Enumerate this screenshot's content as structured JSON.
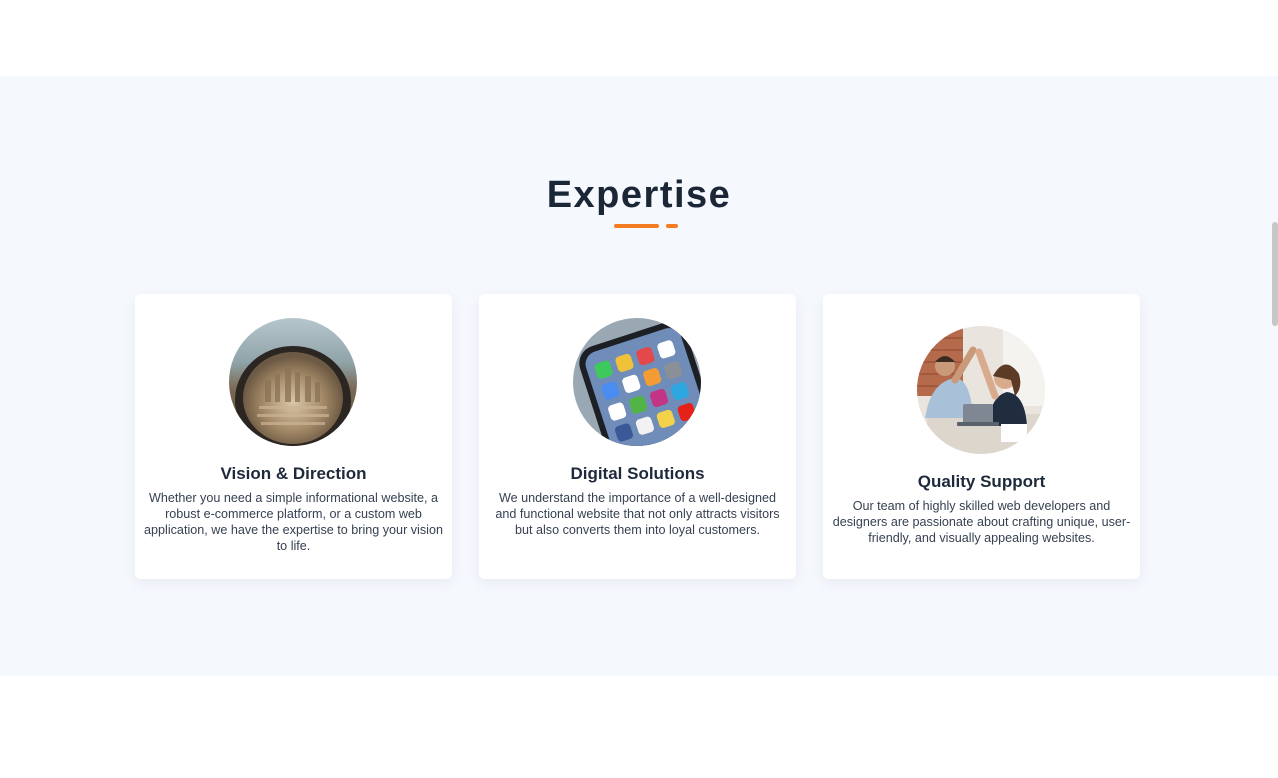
{
  "section": {
    "title": "Expertise"
  },
  "cards": [
    {
      "image": "glasses-city-photo",
      "title": "Vision & Direction",
      "text": "Whether you need a simple informational website, a robust e-commerce platform, or a custom web application, we have the expertise to bring your vision to life."
    },
    {
      "image": "smartphone-apps-photo",
      "title": "Digital Solutions",
      "text": "We understand the importance of a well-designed and functional website that not only attracts visitors but also converts them into loyal customers."
    },
    {
      "image": "team-high-five-photo",
      "title": "Quality Support",
      "text": "Our team of highly skilled web developers and designers are passionate about crafting unique, user-friendly, and visually appealing websites."
    }
  ],
  "colors": {
    "accent": "#f47b20",
    "section_bg": "#f5f8fd",
    "heading": "#1b2636"
  }
}
